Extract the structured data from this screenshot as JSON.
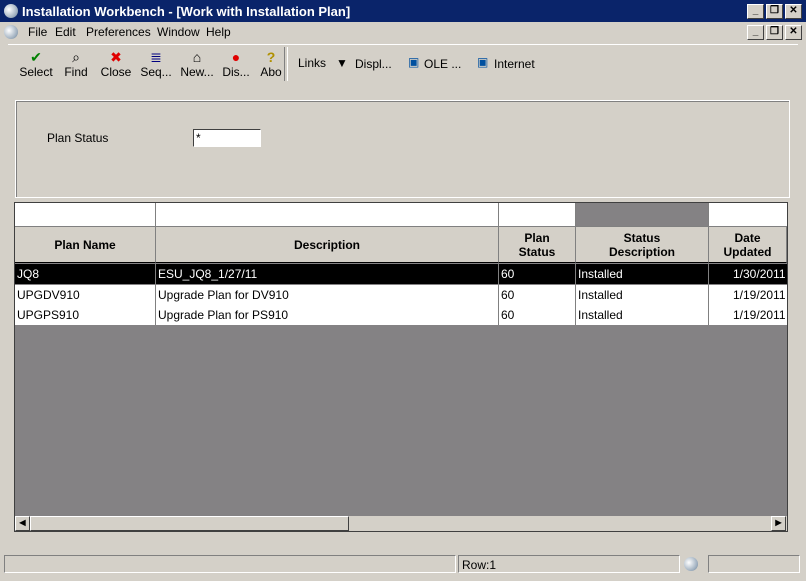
{
  "window": {
    "title": "Installation Workbench - [Work with Installation Plan]"
  },
  "menu": [
    "File",
    "Edit",
    "Preferences",
    "Window",
    "Help"
  ],
  "toolbar": [
    {
      "label": "Select",
      "icon": "checkmark-icon",
      "glyph": "✔",
      "color": "#008000"
    },
    {
      "label": "Find",
      "icon": "find-icon",
      "glyph": "🔍",
      "color": "#000"
    },
    {
      "label": "Close",
      "icon": "close-icon",
      "glyph": "✖",
      "color": "#e00000"
    },
    {
      "label": "Seq...",
      "icon": "sequence-icon",
      "glyph": "≣",
      "color": "#000080"
    },
    {
      "label": "New...",
      "icon": "new-icon",
      "glyph": "🗁",
      "color": "#000"
    },
    {
      "label": "Dis...",
      "icon": "display-icon",
      "glyph": "●",
      "color": "#e00000"
    },
    {
      "label": "Abo",
      "icon": "about-icon",
      "glyph": "?",
      "color": "#c0a000"
    }
  ],
  "links": {
    "links": "Links",
    "displ": "Displ...",
    "ole": "OLE ...",
    "internet": "Internet"
  },
  "form": {
    "plan_status_label": "Plan Status",
    "plan_status_value": "*"
  },
  "grid": {
    "columns": [
      "Plan Name",
      "Description",
      "Plan\nStatus",
      "Status\nDescription",
      "Date\nUpdated"
    ],
    "rows": [
      [
        "JQ8",
        "ESU_JQ8_1/27/11",
        "60",
        "Installed",
        "1/30/2011"
      ],
      [
        "UPGDV910",
        "Upgrade Plan for DV910",
        "60",
        "Installed",
        "1/19/2011"
      ],
      [
        "UPGPS910",
        "Upgrade Plan for PS910",
        "60",
        "Installed",
        "1/19/2011"
      ]
    ]
  },
  "status": {
    "row": "Row:1"
  }
}
